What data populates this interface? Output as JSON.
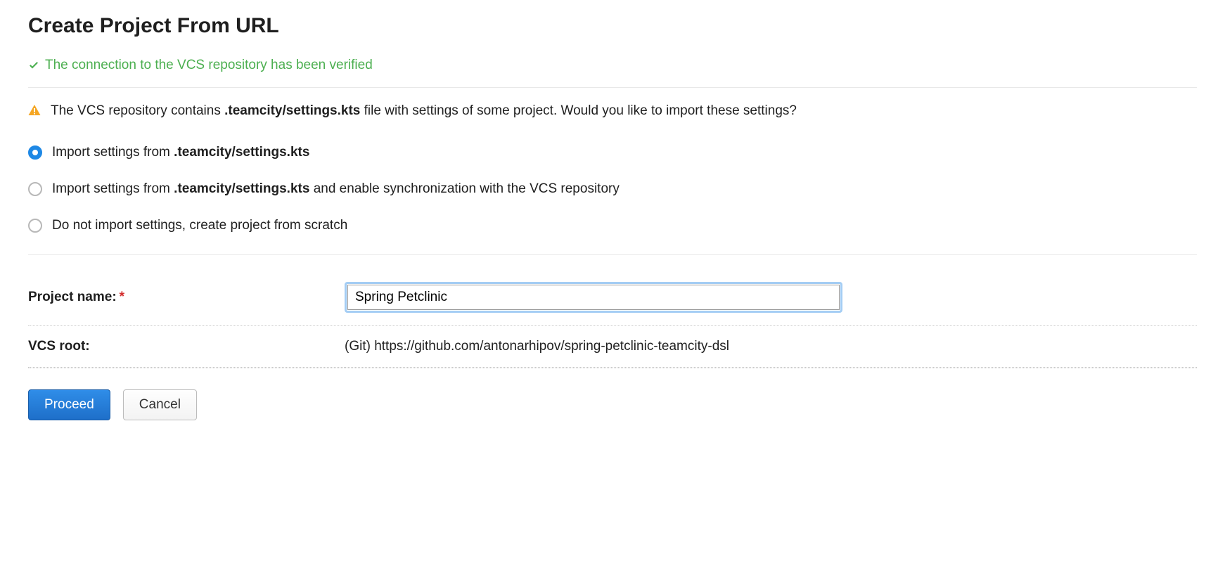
{
  "header": {
    "title": "Create Project From URL"
  },
  "status": {
    "success_message": "The connection to the VCS repository has been verified"
  },
  "warning": {
    "text_before": "The VCS repository contains ",
    "bold_file": ".teamcity/settings.kts",
    "text_after": " file with settings of some project. Would you like to import these settings?"
  },
  "radio_options": {
    "opt1_before": "Import settings from ",
    "opt1_bold": ".teamcity/settings.kts",
    "opt2_before": "Import settings from ",
    "opt2_bold": ".teamcity/settings.kts",
    "opt2_after": " and enable synchronization with the VCS repository",
    "opt3": "Do not import settings, create project from scratch"
  },
  "form": {
    "project_name_label": "Project name:",
    "project_name_value": "Spring Petclinic",
    "vcs_root_label": "VCS root:",
    "vcs_root_value": "(Git) https://github.com/antonarhipov/spring-petclinic-teamcity-dsl"
  },
  "buttons": {
    "proceed": "Proceed",
    "cancel": "Cancel"
  }
}
